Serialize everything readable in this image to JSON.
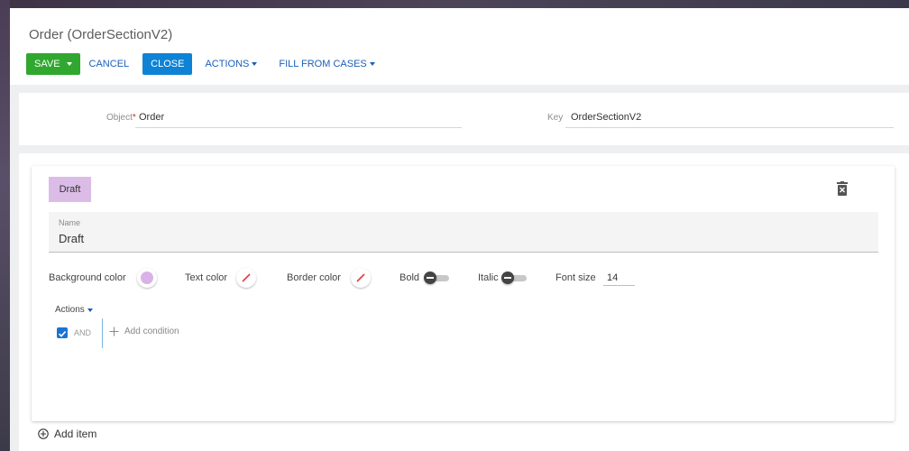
{
  "header": {
    "title": "Order (OrderSectionV2)",
    "toolbar": {
      "save_label": "SAVE",
      "cancel_label": "CANCEL",
      "close_label": "CLOSE",
      "actions_label": "ACTIONS",
      "fill_label": "FILL FROM CASES"
    }
  },
  "fields": {
    "object_label": "Object",
    "object_required_mark": "*",
    "object_value": "Order",
    "key_label": "Key",
    "key_value": "OrderSectionV2"
  },
  "item": {
    "chip_label": "Draft",
    "chip_color": "#dbbce6",
    "name_label": "Name",
    "name_value": "Draft",
    "style": {
      "background_color_label": "Background color",
      "background_color_value": "#d9b3e8",
      "text_color_label": "Text color",
      "border_color_label": "Border color",
      "bold_label": "Bold",
      "italic_label": "Italic",
      "font_size_label": "Font size",
      "font_size_value": "14"
    },
    "actions_label": "Actions",
    "condition": {
      "operator_label": "AND",
      "add_condition_label": "Add condition"
    }
  },
  "add_item_label": "Add item",
  "colors": {
    "save": "#30a72f",
    "close": "#0e83d6",
    "link": "#1b5fb8",
    "checkbox": "#1a73d4"
  }
}
